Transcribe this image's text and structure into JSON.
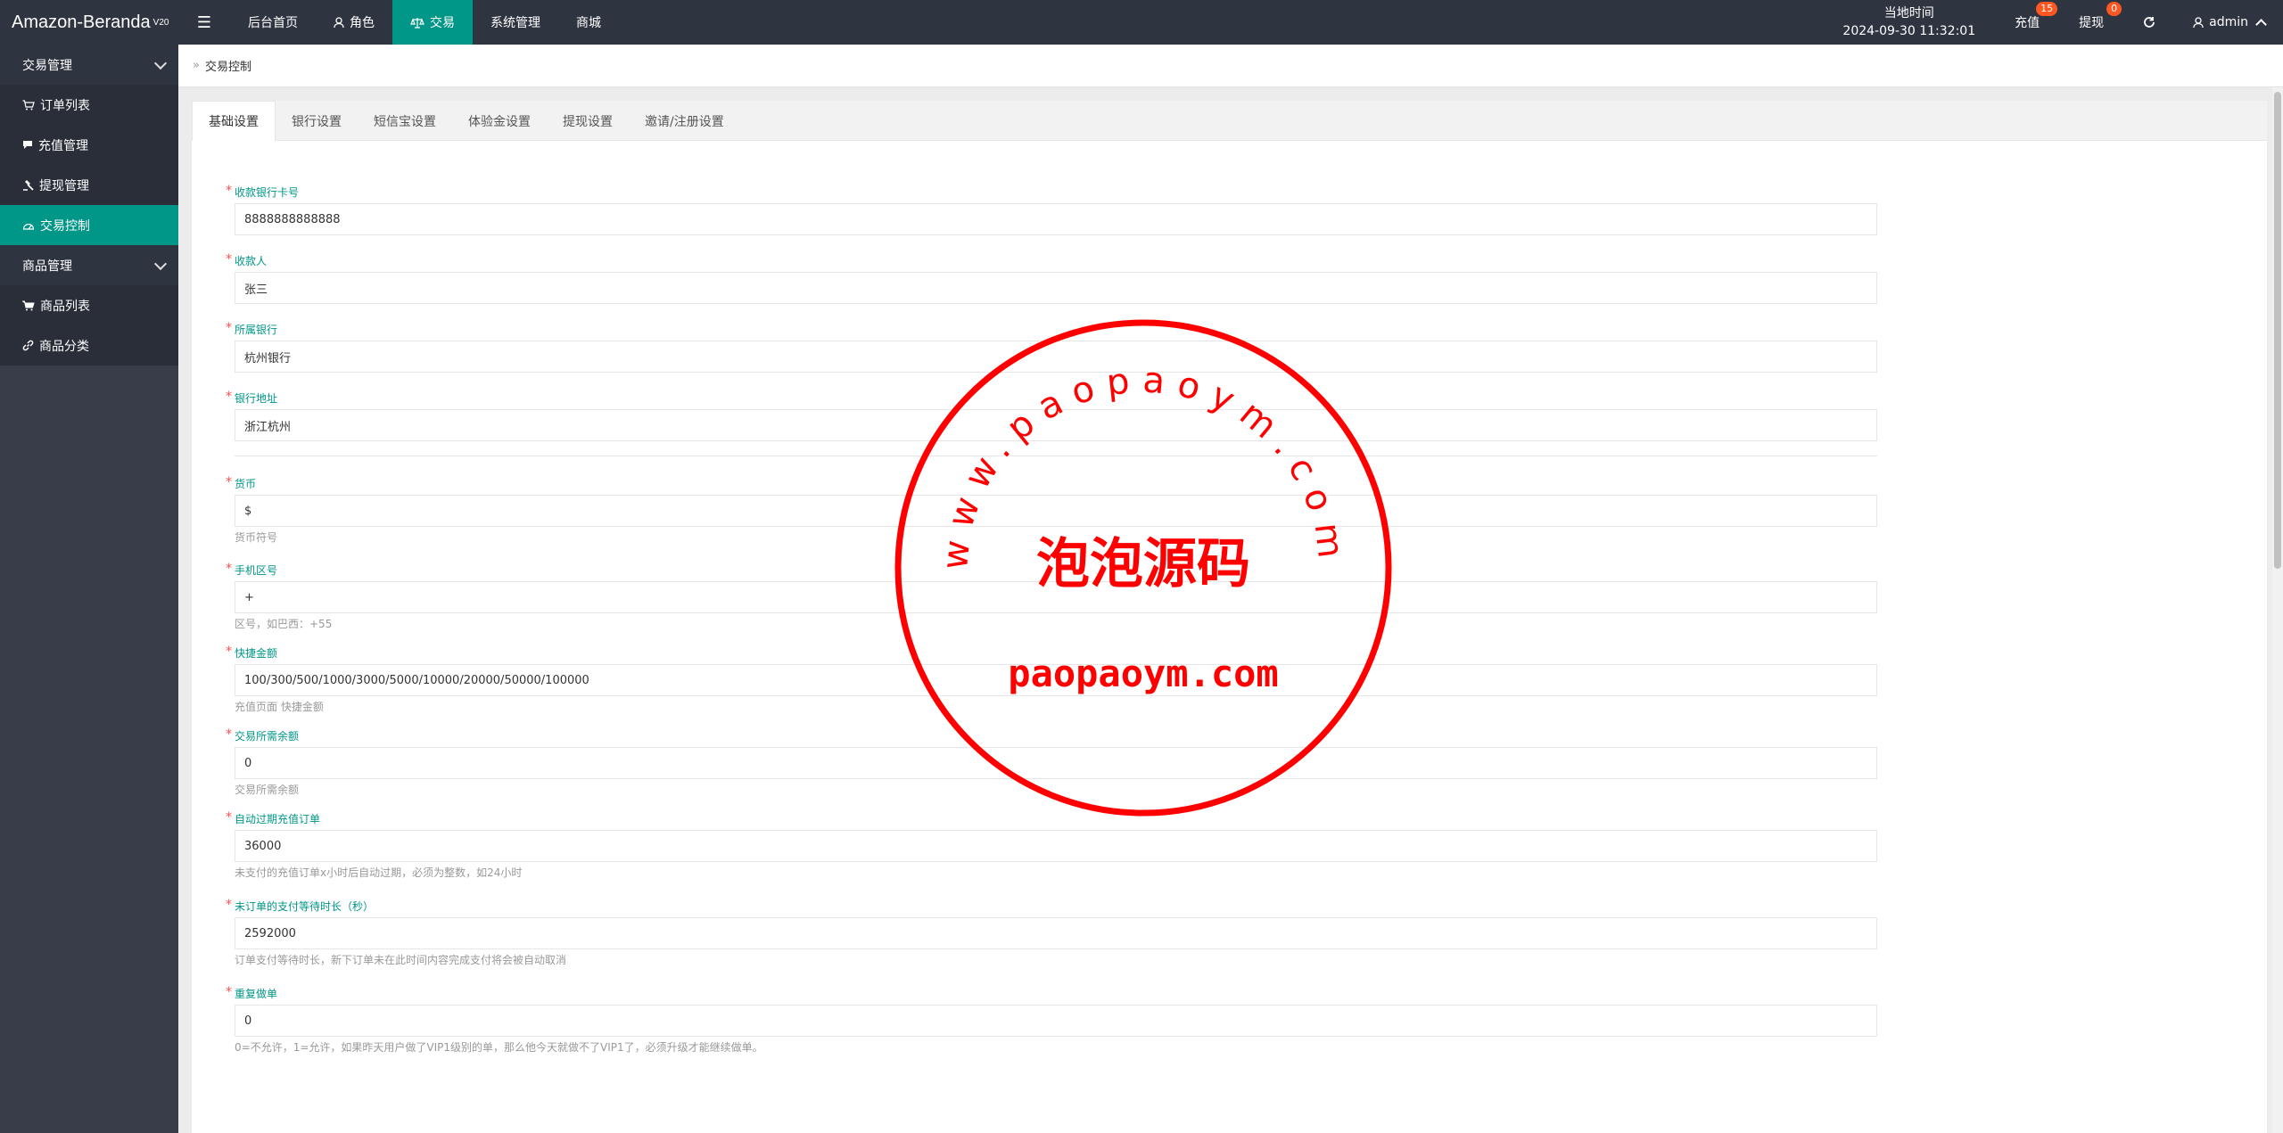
{
  "brand": {
    "name": "Amazon-Beranda",
    "version": "V20"
  },
  "topnav": [
    {
      "label": "后台首页",
      "icon": "",
      "active": false
    },
    {
      "label": "角色",
      "icon": "user-icon",
      "active": false
    },
    {
      "label": "交易",
      "icon": "scale-icon",
      "active": true
    },
    {
      "label": "系统管理",
      "icon": "",
      "active": false
    },
    {
      "label": "商城",
      "icon": "",
      "active": false
    }
  ],
  "clock": {
    "label": "当地时间",
    "value": "2024-09-30 11:32:01"
  },
  "recharge": {
    "label": "充值",
    "badge": "15"
  },
  "withdraw": {
    "label": "提现",
    "badge": "0"
  },
  "user": {
    "name": "admin"
  },
  "sidebar": {
    "groups": [
      {
        "label": "交易管理",
        "items": [
          {
            "label": "订单列表",
            "icon": "cart-icon"
          },
          {
            "label": "充值管理",
            "icon": "comment-icon"
          },
          {
            "label": "提现管理",
            "icon": "gavel-icon"
          },
          {
            "label": "交易控制",
            "icon": "dashboard-icon",
            "active": true
          }
        ]
      },
      {
        "label": "商品管理",
        "items": [
          {
            "label": "商品列表",
            "icon": "cart-icon"
          },
          {
            "label": "商品分类",
            "icon": "link-icon"
          }
        ]
      }
    ]
  },
  "breadcrumb": {
    "current": "交易控制"
  },
  "tabs": [
    "基础设置",
    "银行设置",
    "短信宝设置",
    "体验金设置",
    "提现设置",
    "邀请/注册设置"
  ],
  "fields": [
    {
      "label": "收款银行卡号",
      "value": "8888888888888",
      "help": ""
    },
    {
      "label": "收款人",
      "value": "张三",
      "help": ""
    },
    {
      "label": "所属银行",
      "value": "杭州银行",
      "help": ""
    },
    {
      "label": "银行地址",
      "value": "浙江杭州",
      "help": ""
    },
    {
      "label": "货币",
      "value": "$",
      "help": "货币符号"
    },
    {
      "label": "手机区号",
      "value": "+",
      "help": "区号，如巴西：+55"
    },
    {
      "label": "快捷金额",
      "value": "100/300/500/1000/3000/5000/10000/20000/50000/100000",
      "help": "充值页面 快捷金额"
    },
    {
      "label": "交易所需余额",
      "value": "0",
      "help": "交易所需余额"
    },
    {
      "label": "自动过期充值订单",
      "value": "36000",
      "help": "未支付的充值订单x小时后自动过期，必须为整数，如24小时"
    },
    {
      "label": "未订单的支付等待时长（秒）",
      "value": "2592000",
      "help": "订单支付等待时长，新下订单未在此时间内容完成支付将会被自动取消"
    },
    {
      "label": "重复做单",
      "value": "0",
      "help": "0=不允许，1=允许，如果昨天用户做了VIP1级别的单，那么他今天就做不了VIP1了，必须升级才能继续做单。"
    }
  ],
  "watermark": {
    "top": "www.paopaoym.com",
    "center": "泡泡源码",
    "bottom": "paopaoym.com",
    "color": "#ff0000"
  },
  "colors": {
    "accent": "#009688",
    "topbar": "#2f3441",
    "sidebar": "#393d49",
    "badge": "#ff5722"
  }
}
